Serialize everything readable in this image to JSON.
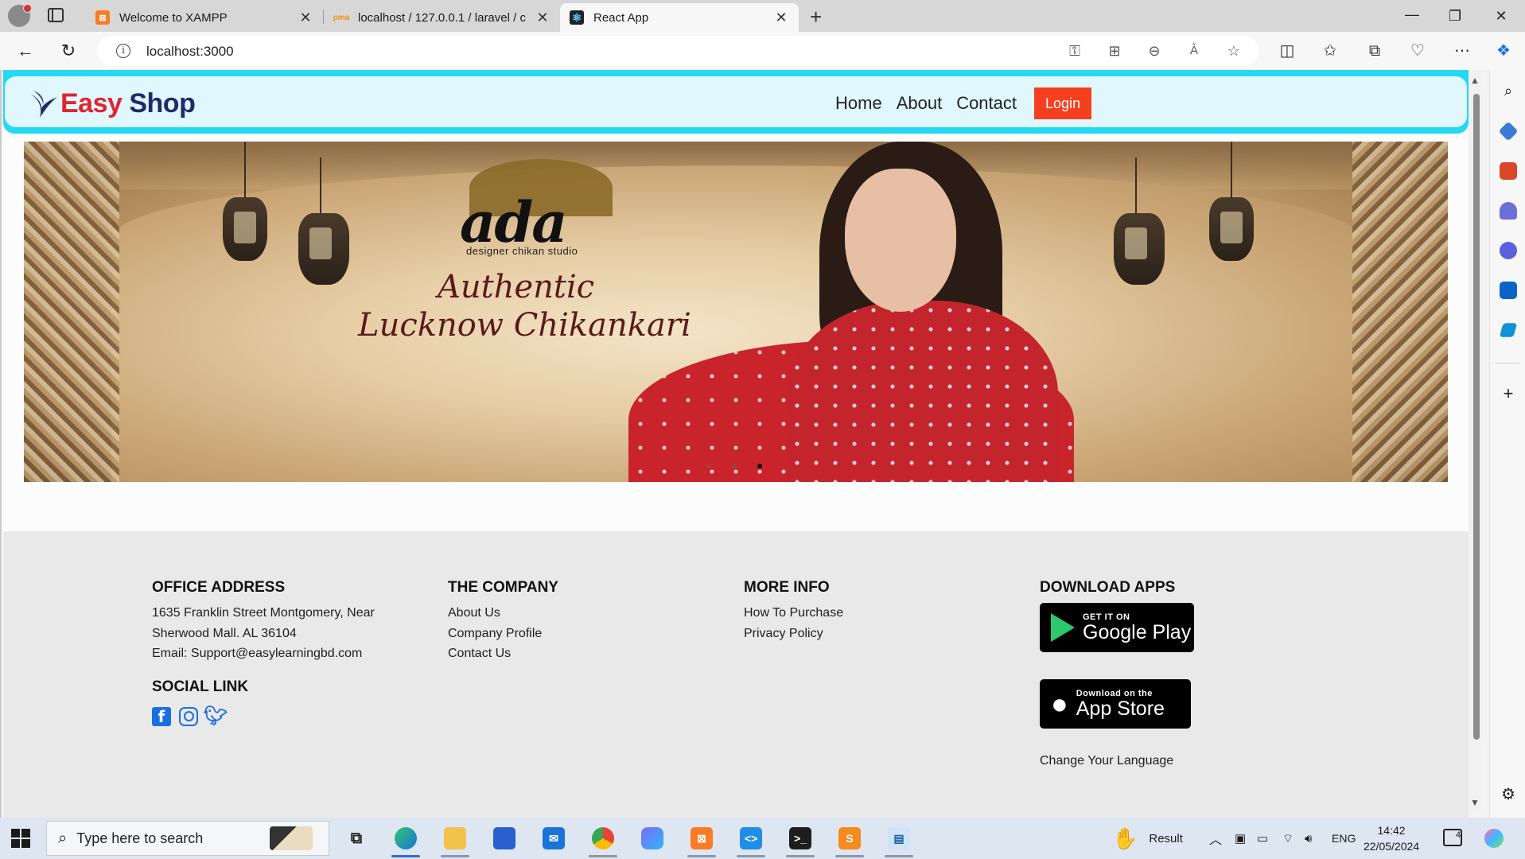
{
  "browser": {
    "tabs": [
      {
        "title": "Welcome to XAMPP",
        "favicon": "xampp-icon",
        "color": "#fb7a24",
        "active": false
      },
      {
        "title": "localhost / 127.0.0.1 / laravel / c",
        "favicon": "phpmyadmin-icon",
        "color": "#f29111",
        "active": false
      },
      {
        "title": "React App",
        "favicon": "react-icon",
        "color": "#20232a",
        "active": true
      }
    ],
    "close_glyph": "✕",
    "new_tab_glyph": "+",
    "window_controls": {
      "minimize": "—",
      "restore": "❐",
      "close": "✕"
    },
    "address_bar": {
      "url": "localhost:3000",
      "info_glyph": "i"
    }
  },
  "site": {
    "logo": {
      "word1": "Easy",
      "word2": " Shop",
      "colors": {
        "easy": "#e2242f",
        "shop": "#1f2a66"
      }
    },
    "nav": {
      "home": "Home",
      "about": "About",
      "contact": "Contact",
      "login": "Login"
    },
    "banner": {
      "brand_name": "ada",
      "brand_sub": "designer chikan studio",
      "tagline_line1": "Authentic",
      "tagline_line2": "Lucknow Chikankari",
      "carousel_active_index": 3,
      "carousel_count": 3
    },
    "footer": {
      "office": {
        "heading": "OFFICE ADDRESS",
        "line1": "1635 Franklin Street Montgomery, Near",
        "line2": "Sherwood Mall. AL 36104",
        "email": "Email: Support@easylearningbd.com"
      },
      "social": {
        "heading": "SOCIAL LINK",
        "icons": [
          "facebook-icon",
          "instagram-icon",
          "twitter-icon"
        ]
      },
      "company": {
        "heading": "THE COMPANY",
        "links": [
          "About Us",
          "Company Profile",
          "Contact Us"
        ]
      },
      "more": {
        "heading": "MORE INFO",
        "links": [
          "How To Purchase",
          "Privacy Policy"
        ]
      },
      "apps": {
        "heading": "DOWNLOAD APPS",
        "google_small": "GET IT ON",
        "google_big": "Google Play",
        "apple_small": "Download on the",
        "apple_big": "App Store",
        "language": "Change Your Language"
      }
    }
  },
  "taskbar": {
    "search_placeholder": "Type here to search",
    "weather_label": "Result",
    "language": "ENG",
    "time": "14:42",
    "date": "22/05/2024",
    "notification_count": "4"
  }
}
